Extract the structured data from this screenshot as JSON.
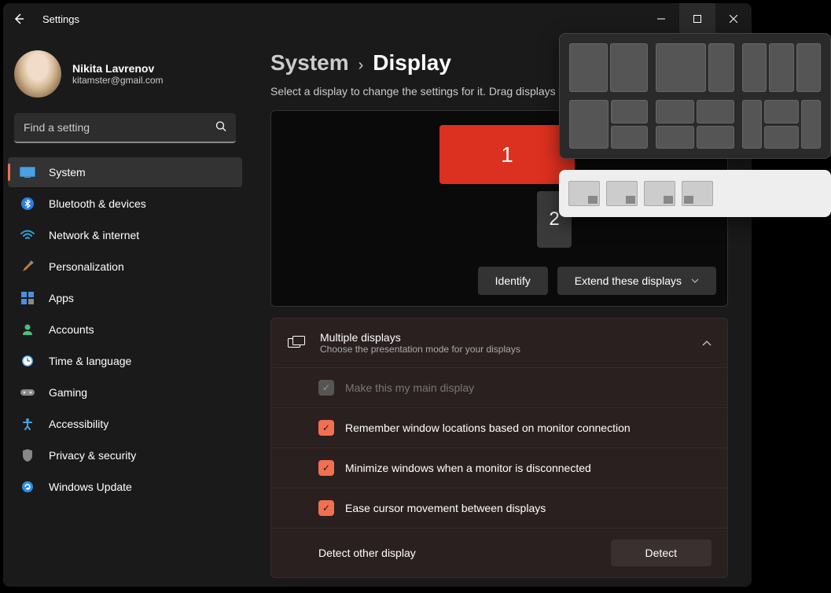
{
  "window": {
    "title": "Settings"
  },
  "profile": {
    "name": "Nikita Lavrenov",
    "email": "kitamster@gmail.com"
  },
  "search": {
    "placeholder": "Find a setting"
  },
  "nav": [
    {
      "label": "System",
      "icon": "🖥️",
      "active": true
    },
    {
      "label": "Bluetooth & devices",
      "icon": "bt"
    },
    {
      "label": "Network & internet",
      "icon": "wifi"
    },
    {
      "label": "Personalization",
      "icon": "🖌️"
    },
    {
      "label": "Apps",
      "icon": "apps"
    },
    {
      "label": "Accounts",
      "icon": "👤"
    },
    {
      "label": "Time & language",
      "icon": "🕐"
    },
    {
      "label": "Gaming",
      "icon": "🎮"
    },
    {
      "label": "Accessibility",
      "icon": "acc"
    },
    {
      "label": "Privacy & security",
      "icon": "🛡️"
    },
    {
      "label": "Windows Update",
      "icon": "🔄"
    }
  ],
  "breadcrumb": {
    "parent": "System",
    "current": "Display"
  },
  "subtitle": "Select a display to change the settings for it. Drag displays to rearrange them.",
  "monitors": {
    "m1": "1",
    "m2": "2"
  },
  "actions": {
    "identify": "Identify",
    "extend": "Extend these displays"
  },
  "panel": {
    "title": "Multiple displays",
    "sub": "Choose the presentation mode for your displays",
    "checks": [
      {
        "label": "Make this my main display",
        "state": "disabled"
      },
      {
        "label": "Remember window locations based on monitor connection",
        "state": "checked"
      },
      {
        "label": "Minimize windows when a monitor is disconnected",
        "state": "checked"
      },
      {
        "label": "Ease cursor movement between displays",
        "state": "checked"
      }
    ],
    "detect_label": "Detect other display",
    "detect_btn": "Detect"
  }
}
